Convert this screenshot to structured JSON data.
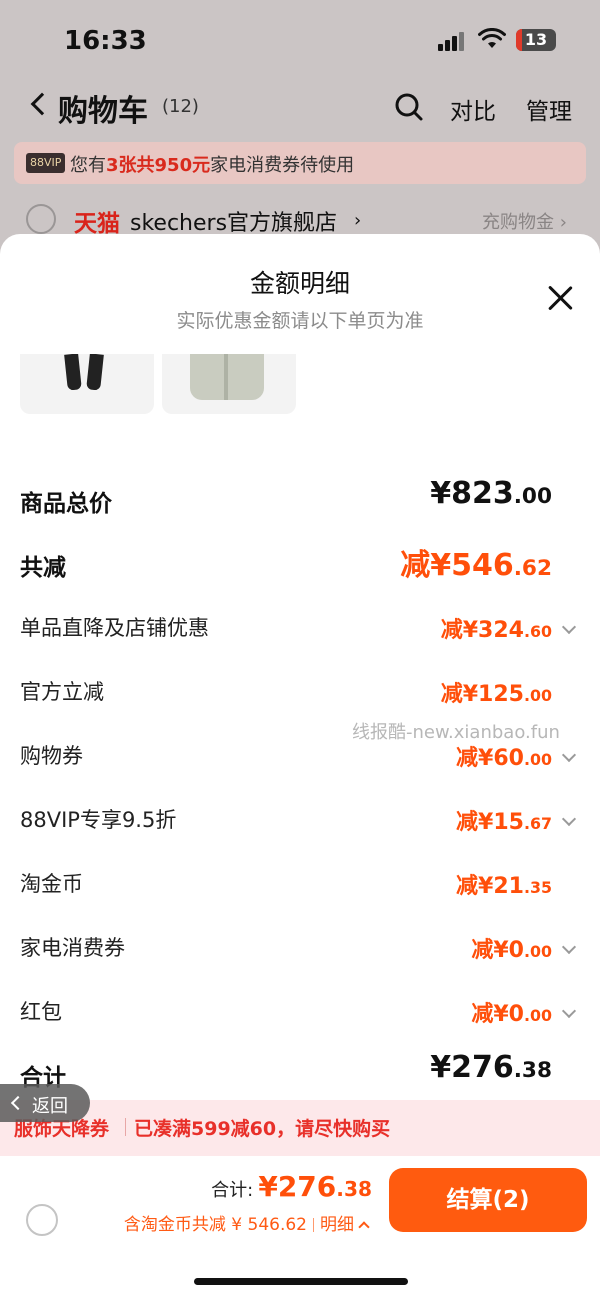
{
  "status_bar": {
    "time": "16:33",
    "battery": "13"
  },
  "nav": {
    "title": "购物车",
    "count": "(12)",
    "compare": "对比",
    "manage": "管理"
  },
  "vip_banner": {
    "tag": "88VIP",
    "text_prefix": "您有",
    "highlight": "3张共950元",
    "text_suffix": "家电消费券待使用"
  },
  "store": {
    "tmall": "天猫",
    "name": "skechers官方旗舰店",
    "chev": "›",
    "right_label": "充购物金 ›"
  },
  "sheet": {
    "title": "金额明细",
    "subtitle": "实际优惠金额请以下单页为准",
    "rows": [
      {
        "label": "商品总价",
        "prefix": "¥",
        "int": "823",
        "dec": ".00"
      },
      {
        "label": "共减",
        "prefix": "减¥",
        "int": "546",
        "dec": ".62"
      },
      {
        "label": "单品直降及店铺优惠",
        "prefix": "减¥",
        "int": "324",
        "dec": ".60"
      },
      {
        "label": "官方立减",
        "prefix": "减¥",
        "int": "125",
        "dec": ".00"
      },
      {
        "label": "购物券",
        "prefix": "减¥",
        "int": "60",
        "dec": ".00"
      },
      {
        "label": "88VIP专享9.5折",
        "prefix": "减¥",
        "int": "15",
        "dec": ".67"
      },
      {
        "label": "淘金币",
        "prefix": "减¥",
        "int": "21",
        "dec": ".35"
      },
      {
        "label": "家电消费券",
        "prefix": "减¥",
        "int": "0",
        "dec": ".00"
      },
      {
        "label": "红包",
        "prefix": "减¥",
        "int": "0",
        "dec": ".00"
      },
      {
        "label": "合计",
        "prefix": "¥",
        "int": "276",
        "dec": ".38"
      }
    ]
  },
  "watermark": "线报酷-new.xianbao.fun",
  "back_pill": "返回",
  "promo": {
    "tag": "服饰天降券",
    "text": "已凑满599减60，请尽快购买"
  },
  "footer": {
    "total_label": "合计:",
    "total_prefix": "¥",
    "total_int": "276",
    "total_dec": ".38",
    "sub_text": "含淘金币共减 ¥ 546.62",
    "detail": "明细",
    "checkout": "结算(2)"
  },
  "colors": {
    "accent": "#ff5b0f",
    "promo_red": "#e8302a",
    "tmall_red": "#d9241b"
  }
}
